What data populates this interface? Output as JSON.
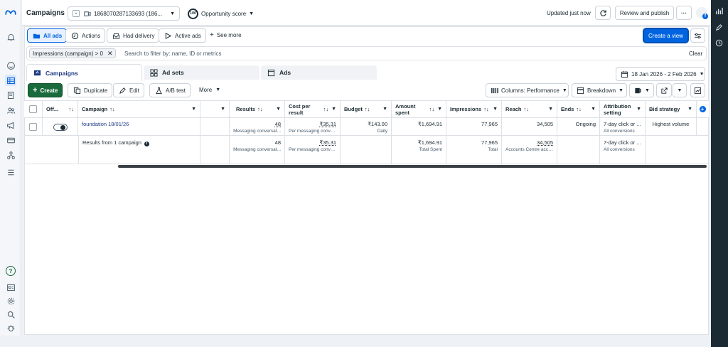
{
  "header": {
    "title": "Campaigns",
    "account_id": "1868070287133693 (186...",
    "opportunity_badge": "100",
    "opportunity_label": "Opportunity score",
    "updated": "Updated just now",
    "review_publish": "Review and publish",
    "more": "···"
  },
  "toolbar": {
    "all_ads": "All ads",
    "actions": "Actions",
    "had_delivery": "Had delivery",
    "active_ads": "Active ads",
    "see_more": "See more",
    "create_view": "Create a view"
  },
  "filter": {
    "chip": "Impressions (campaign) > 0",
    "placeholder": "Search to filter by: name, ID or metrics",
    "clear": "Clear"
  },
  "tabs": {
    "campaigns": "Campaigns",
    "ad_sets": "Ad sets",
    "ads": "Ads",
    "date_range": "18 Jan 2026 - 2 Feb 2026"
  },
  "actions_bar": {
    "create": "Create",
    "duplicate": "Duplicate",
    "edit": "Edit",
    "ab_test": "A/B test",
    "more": "More",
    "columns": "Columns: Performance",
    "breakdown": "Breakdown"
  },
  "table": {
    "headers": {
      "off": "Off...",
      "campaign": "Campaign",
      "results": "Results",
      "cost": "Cost per result",
      "budget": "Budget",
      "amount": "Amount spent",
      "impressions": "Impressions",
      "reach": "Reach",
      "ends": "Ends",
      "attribution": "Attribution setting",
      "bid": "Bid strategy"
    },
    "row": {
      "campaign": "foundation 18/01/26",
      "results": "48",
      "results_sub": "Messaging conversat...",
      "cost": "₹35.31",
      "cost_sub": "Per messaging conve...",
      "budget": "₹143.00",
      "budget_sub": "Daily",
      "amount": "₹1,694.91",
      "impressions": "77,965",
      "reach": "34,505",
      "ends": "Ongoing",
      "attribution": "7-day click or ...",
      "attribution_sub": "All conversions",
      "bid": "Highest volume"
    },
    "summary": {
      "label": "Results from 1 campaign",
      "results": "48",
      "results_sub": "Messaging conversat...",
      "cost": "₹35.31",
      "cost_sub": "Per messaging conve...",
      "amount": "₹1,694.91",
      "amount_sub": "Total Spent",
      "impressions": "77,965",
      "impressions_sub": "Total",
      "reach": "34,505",
      "reach_sub": "Accounts Centre acco...",
      "attribution": "7-day click or ...",
      "attribution_sub": "All conversions"
    }
  },
  "colors": {
    "accent": "#0064e0",
    "create_green": "#1a6b3c",
    "link": "#1c3a80"
  }
}
